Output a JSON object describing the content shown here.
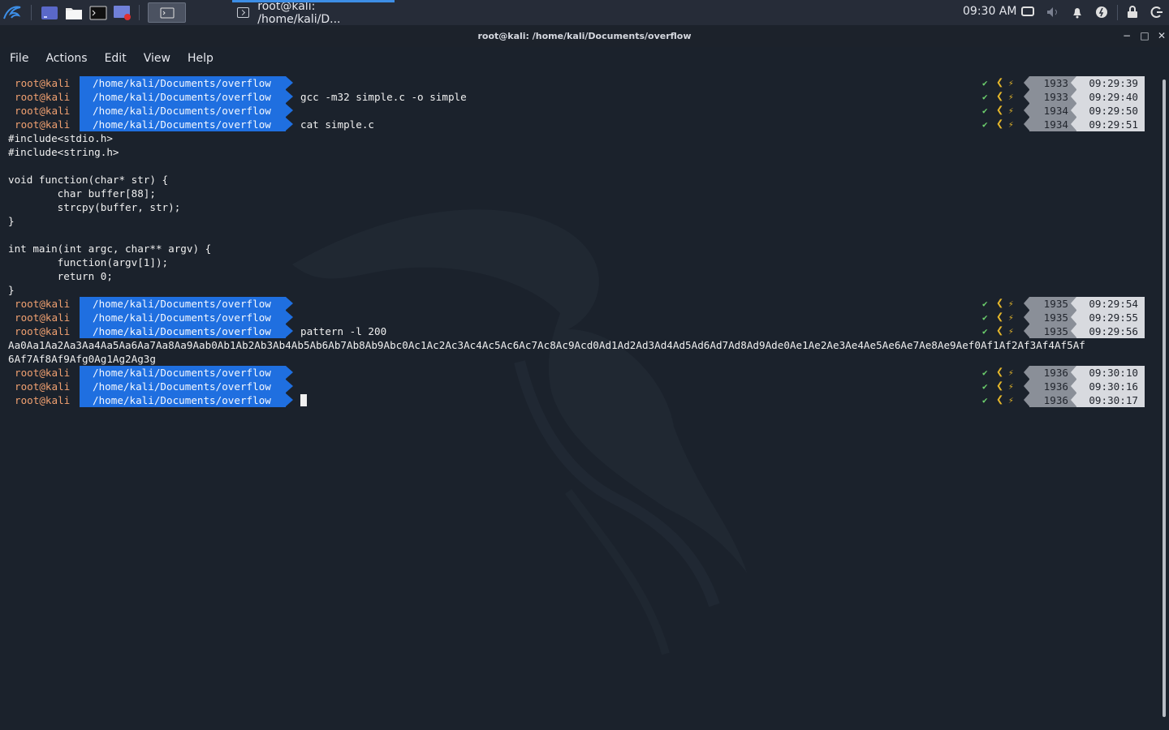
{
  "taskbar": {
    "clock": "09:30 AM",
    "window_task_label": "root@kali: /home/kali/D...",
    "icons": [
      "kali-dragon-icon",
      "workspace-icon",
      "file-manager-icon",
      "terminal-icon",
      "screen-recorder-icon"
    ]
  },
  "window": {
    "title": "root@kali: /home/kali/Documents/overflow",
    "minimize": "−",
    "maximize": "□",
    "close": "✕"
  },
  "menu": [
    "File",
    "Actions",
    "Edit",
    "View",
    "Help"
  ],
  "prompt": {
    "user": "root@kali",
    "path": "/home/kali/Documents/overflow",
    "check": "✔",
    "lt": "❮",
    "bolt": "⚡"
  },
  "terminal": {
    "prompts": [
      {
        "cmd": "",
        "hist": "1933",
        "time": "09:29:39"
      },
      {
        "cmd": "gcc -m32 simple.c -o simple",
        "hist": "1933",
        "time": "09:29:40"
      },
      {
        "cmd": "",
        "hist": "1934",
        "time": "09:29:50"
      },
      {
        "cmd": "cat simple.c",
        "hist": "1934",
        "time": "09:29:51"
      },
      {
        "cmd": "",
        "hist": "1935",
        "time": "09:29:54"
      },
      {
        "cmd": "",
        "hist": "1935",
        "time": "09:29:55"
      },
      {
        "cmd": "pattern -l 200",
        "hist": "1935",
        "time": "09:29:56"
      },
      {
        "cmd": "",
        "hist": "1936",
        "time": "09:30:10"
      },
      {
        "cmd": "",
        "hist": "1936",
        "time": "09:30:16"
      },
      {
        "cmd": "",
        "hist": "1936",
        "time": "09:30:17"
      }
    ],
    "source_lines": [
      "#include<stdio.h>",
      "#include<string.h>",
      "",
      "void function(char* str) {",
      "        char buffer[88];",
      "        strcpy(buffer, str);",
      "}",
      "",
      "int main(int argc, char** argv) {",
      "        function(argv[1]);",
      "        return 0;",
      "}"
    ],
    "pattern_lines": [
      "Aa0Aa1Aa2Aa3Aa4Aa5Aa6Aa7Aa8Aa9Aab0Ab1Ab2Ab3Ab4Ab5Ab6Ab7Ab8Ab9Abc0Ac1Ac2Ac3Ac4Ac5Ac6Ac7Ac8Ac9Acd0Ad1Ad2Ad3Ad4Ad5Ad6Ad7Ad8Ad9Ade0Ae1Ae2Ae3Ae4Ae5Ae6Ae7Ae8Ae9Aef0Af1Af2Af3Af4Af5Af",
      "6Af7Af8Af9Afg0Ag1Ag2Ag3g"
    ]
  },
  "colors": {
    "accent": "#1f6fe0",
    "user": "#f0a070",
    "ok": "#6ed36e",
    "warn": "#e3b52a",
    "background": "#1b222c"
  }
}
